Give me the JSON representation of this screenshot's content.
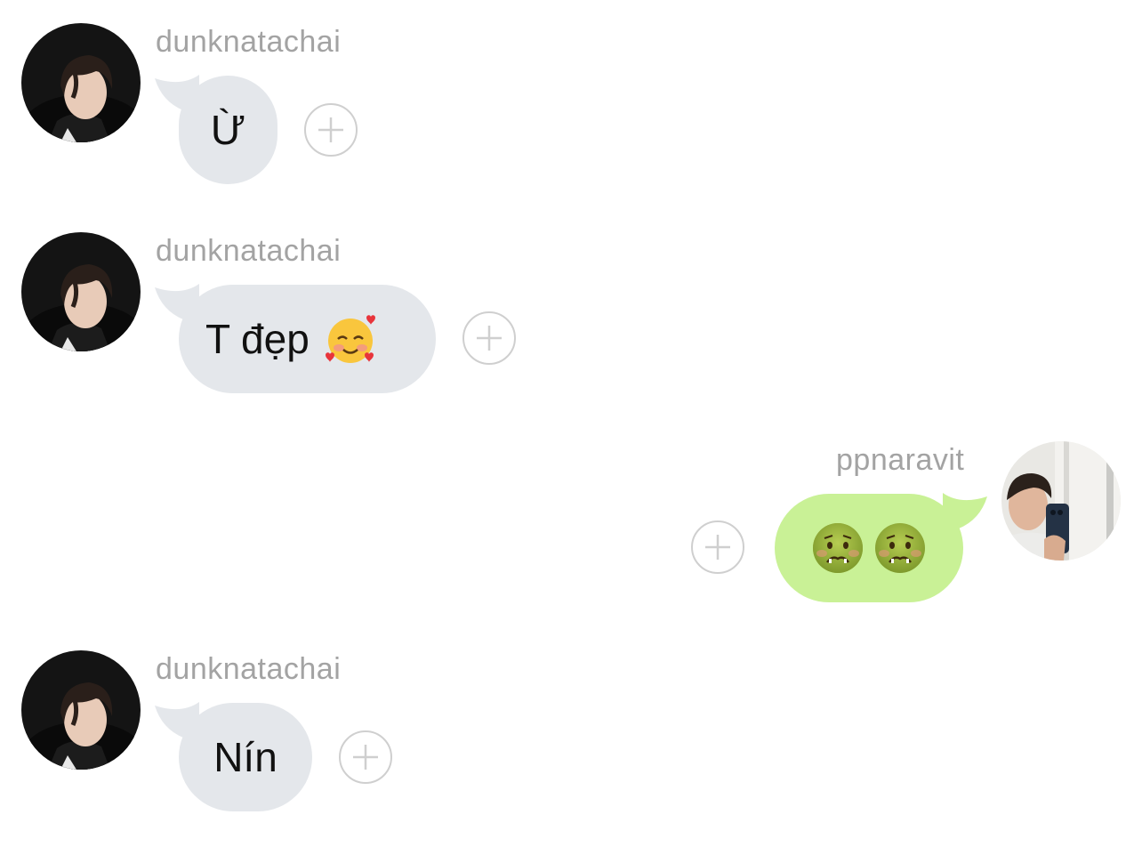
{
  "messages": [
    {
      "sender": "dunknatachai",
      "direction": "incoming",
      "text": "Ừ",
      "emoji": []
    },
    {
      "sender": "dunknatachai",
      "direction": "incoming",
      "text": "T đẹp",
      "emoji": [
        "smiling-face-with-hearts"
      ]
    },
    {
      "sender": "ppnaravit",
      "direction": "outgoing",
      "text": "",
      "emoji": [
        "nauseated-face",
        "nauseated-face"
      ]
    },
    {
      "sender": "dunknatachai",
      "direction": "incoming",
      "text": "Nín",
      "emoji": []
    }
  ],
  "colors": {
    "incoming_bubble": "#e4e7eb",
    "outgoing_bubble": "#c9f196",
    "username": "#a3a3a3",
    "react_border": "#cfcfcf"
  },
  "icons": {
    "react_button": "plus-circle-icon"
  }
}
